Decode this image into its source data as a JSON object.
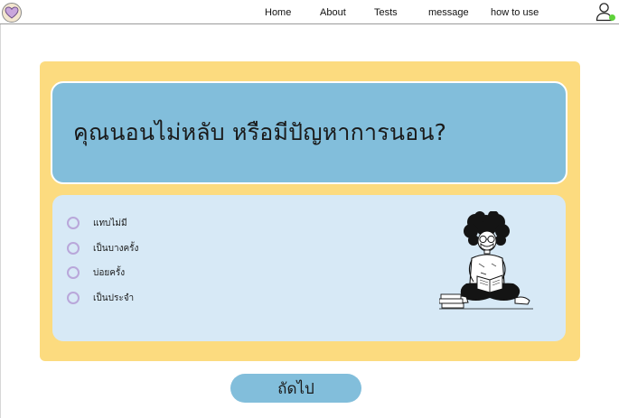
{
  "nav": {
    "logo_icon": "heart-logo-icon",
    "links": [
      {
        "label": "Home"
      },
      {
        "label": "About"
      },
      {
        "label": "Tests"
      },
      {
        "label": "message"
      },
      {
        "label": "how to use"
      }
    ],
    "user_icon": "user-icon",
    "online_status_color": "#5ed23a"
  },
  "quiz": {
    "question": "คุณนอนไม่หลับ หรือมีปัญหาการนอน?",
    "options": [
      {
        "label": "แทบไม่มี",
        "selected": false
      },
      {
        "label": "เป็นบางครั้ง",
        "selected": false
      },
      {
        "label": "บ่อยครั้ง",
        "selected": false
      },
      {
        "label": "เป็นประจำ",
        "selected": false
      }
    ],
    "illustration_icon": "person-reading-illustration",
    "next_label": "ถัดไป"
  },
  "colors": {
    "card_background": "#fcdb7f",
    "question_background": "#82bedb",
    "answers_background": "#d7e9f6",
    "radio_border": "#b9a7da",
    "button_background": "#82bedb"
  }
}
